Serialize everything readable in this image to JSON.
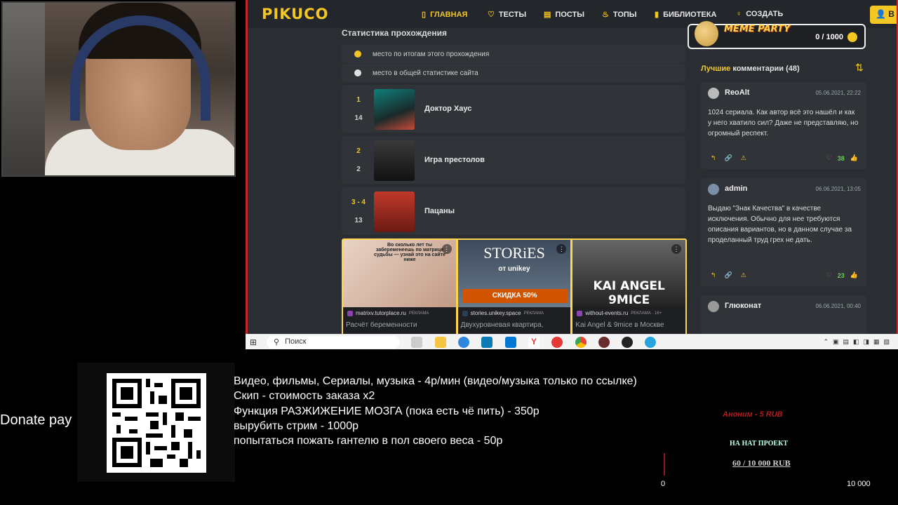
{
  "site": {
    "logo": "PIKUCO",
    "nav": [
      {
        "label": "ГЛАВНАЯ",
        "icon": "bookmark-icon",
        "active": true
      },
      {
        "label": "ТЕСТЫ",
        "icon": "shield-icon",
        "active": false
      },
      {
        "label": "ПОСТЫ",
        "icon": "document-icon",
        "active": false
      },
      {
        "label": "ТОПЫ",
        "icon": "flame-icon",
        "active": false
      },
      {
        "label": "БИБЛИОТЕКА",
        "icon": "book-icon",
        "active": false
      },
      {
        "label": "СОЗДАТЬ",
        "icon": "bulb-icon",
        "active": false
      }
    ],
    "login_label": "В"
  },
  "stats": {
    "title": "Статистика прохождения",
    "legend": [
      {
        "label": "место по итогам этого прохождения",
        "color": "#f3c623"
      },
      {
        "label": "место в общей статистике сайта",
        "color": "#e0e0e0"
      }
    ],
    "items": [
      {
        "rank_run": "1",
        "rank_site": "14",
        "title": "Доктор Хаус"
      },
      {
        "rank_run": "2",
        "rank_site": "2",
        "title": "Игра престолов"
      },
      {
        "rank_run": "3 - 4",
        "rank_site": "13",
        "title": "Пацаны"
      }
    ]
  },
  "ads": [
    {
      "overlay": "Во сколько лет ты забеременеешь по матрице судьбы — узнай это на сайте ниже",
      "source": "matrixv.tutorplace.ru",
      "tag": "РЕКЛАМА",
      "caption": "Расчёт беременности"
    },
    {
      "overlay_top": "STORiES",
      "overlay_sub": "от unikey",
      "overlay_promo": "СКИДКА 50%",
      "source": "stories.unikey.space",
      "tag": "РЕКЛАМА",
      "caption": "Двухуровневая квартира,"
    },
    {
      "overlay": "KAI ANGEL 9MICE",
      "source": "without-events.ru",
      "tag": "РЕКЛАМА · 16+",
      "caption": "Kai Angel & 9mice в Москве"
    }
  ],
  "meme_party": {
    "title": "MEME PARTY",
    "score": "0 / 1000"
  },
  "comments": {
    "heading_highlight": "Лучшие",
    "heading_rest": "комментарии (48)",
    "items": [
      {
        "name": "ReoAlt",
        "date": "05.06.2021, 22:22",
        "text": "1024 сериала. Как автор всё это нашёл и как у него хватило сил? Даже не представляю, но огромный респект.",
        "votes": "38"
      },
      {
        "name": "admin",
        "date": "06.06.2021, 13:05",
        "text": "Выдаю \"Знак Качества\" в качестве исключения. Обычно для нее требуются описания вариантов, но в данном случае за проделанный труд грех не дать.",
        "votes": "23"
      },
      {
        "name": "Глюконат",
        "date": "06.06.2021, 00:40",
        "text": "",
        "votes": ""
      }
    ]
  },
  "taskbar": {
    "search_placeholder": "Поиск"
  },
  "overlay": {
    "donate_label": "Donate pay",
    "price_list": [
      "Видео, фильмы, Сериалы, музыка - 4р/мин (видео/музыка только по ссылке)",
      "Скип - стоимость заказа x2",
      "Функция РАЗЖИЖЕНИЕ МОЗГА (пока есть чё пить) - 350р",
      "вырубить стрим - 1000р",
      "попытаться пожать гантелю в пол своего веса - 50р"
    ],
    "donor": "Аноним - 5 RUB",
    "goal_subtitle": "НА НАТ ПРОЕКТ",
    "goal": "60 / 10 000 RUB",
    "goal_min": "0",
    "goal_max": "10 000"
  }
}
